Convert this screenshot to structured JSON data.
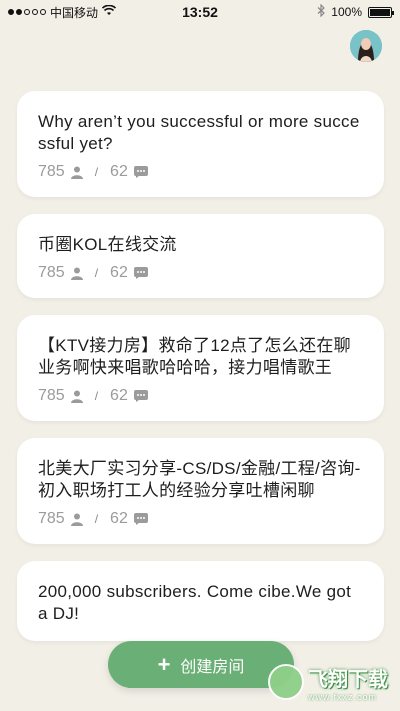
{
  "status_bar": {
    "carrier": "中国移动",
    "time": "13:52",
    "battery": "100%"
  },
  "rooms": [
    {
      "title": "Why aren’t you successful or more successful yet?",
      "listeners": "785",
      "separator": "/",
      "messages": "62"
    },
    {
      "title": "币圈KOL在线交流",
      "listeners": "785",
      "separator": "/",
      "messages": "62"
    },
    {
      "title": "【KTV接力房】救命了12点了怎么还在聊业务啊快来唱歌哈哈哈，接力唱情歌王",
      "listeners": "785",
      "separator": "/",
      "messages": "62"
    },
    {
      "title": "北美大厂实习分享-CS/DS/金融/工程/咨询-初入职场打工人的经验分享吐槽闲聊",
      "listeners": "785",
      "separator": "/",
      "messages": "62"
    },
    {
      "title": "200,000 subscribers. Come cibe.We got a DJ!",
      "listeners": "",
      "separator": "",
      "messages": ""
    }
  ],
  "create_button": {
    "icon": "+",
    "label": "创建房间"
  },
  "watermark": {
    "main": "飞翔下载",
    "sub": "www.fxxz.com"
  },
  "colors": {
    "background": "#f2efe7",
    "accent": "#6aaf76",
    "card": "#ffffff",
    "meta": "#9b9b9b"
  }
}
